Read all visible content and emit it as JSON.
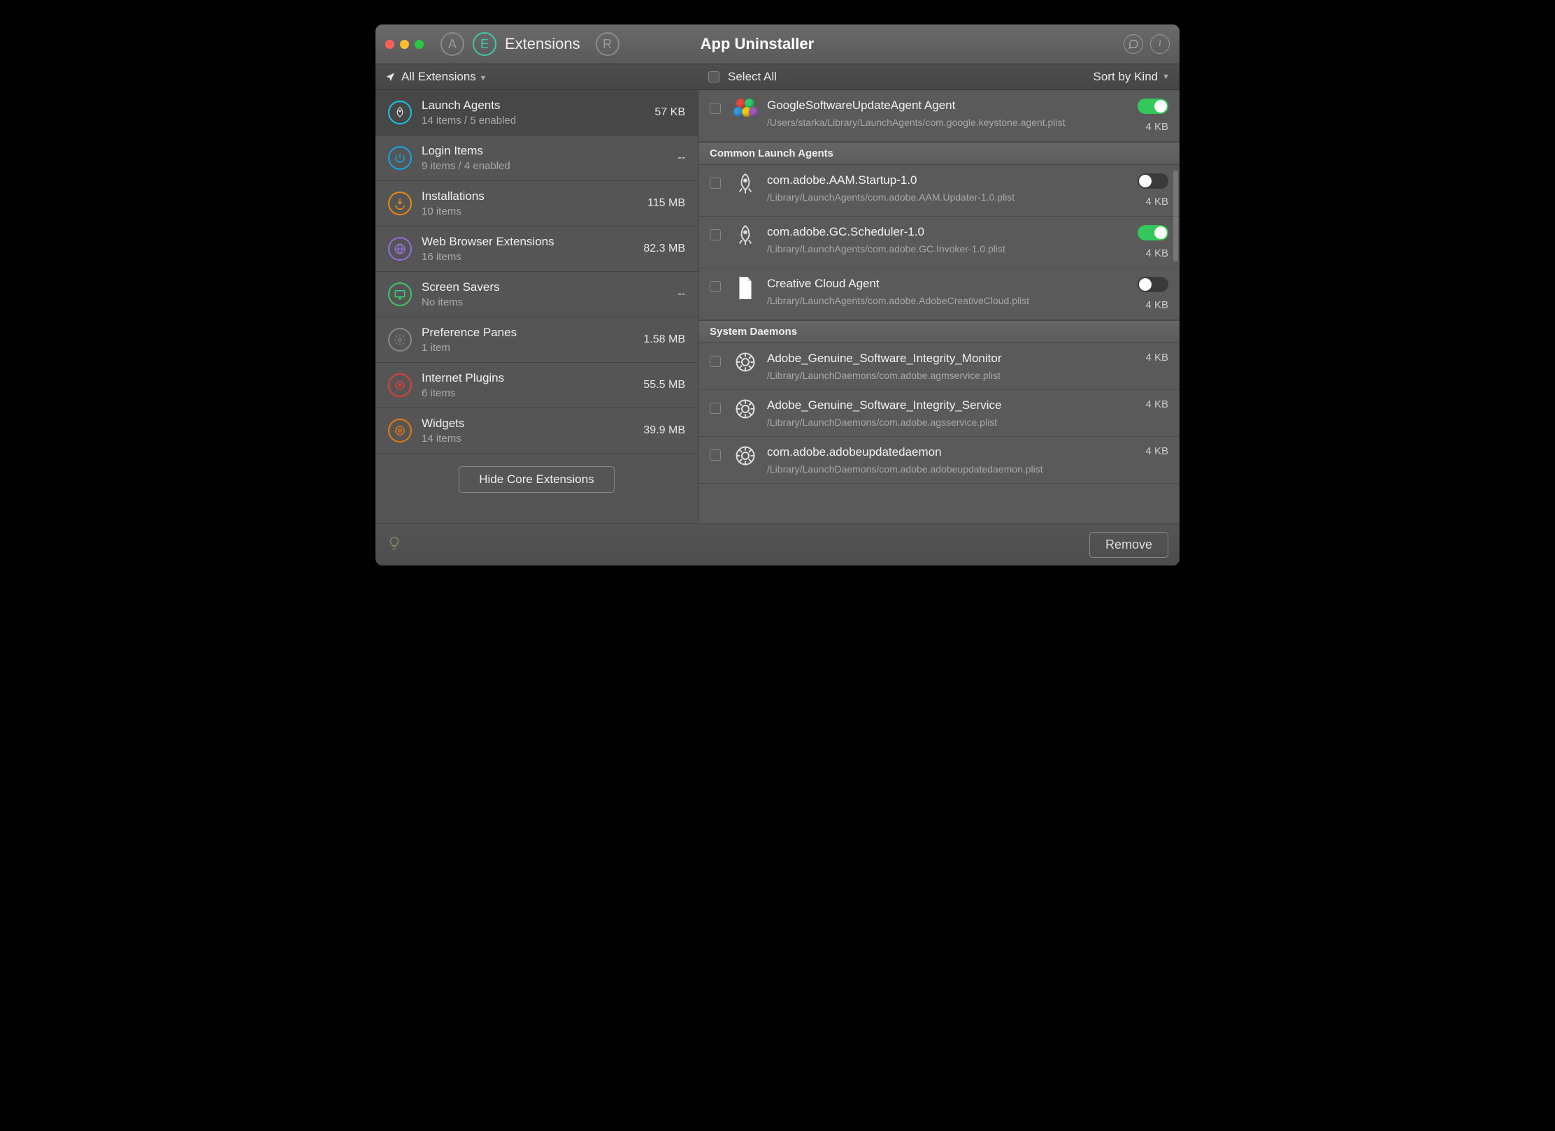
{
  "header": {
    "tab_label": "Extensions",
    "app_title": "App Uninstaller"
  },
  "subbar": {
    "filter_label": "All Extensions",
    "select_all_label": "Select All",
    "sort_label": "Sort by Kind"
  },
  "sidebar": {
    "categories": [
      {
        "title": "Launch Agents",
        "sub": "14 items / 5 enabled",
        "size": "57 KB",
        "color": "#16c4ea",
        "kind": "rocket"
      },
      {
        "title": "Login Items",
        "sub": "9 items / 4 enabled",
        "size": "--",
        "color": "#12a7e8",
        "kind": "power"
      },
      {
        "title": "Installations",
        "sub": "10 items",
        "size": "115 MB",
        "color": "#e88b12",
        "kind": "download"
      },
      {
        "title": "Web Browser Extensions",
        "sub": "16 items",
        "size": "82.3 MB",
        "color": "#9a6de0",
        "kind": "globe"
      },
      {
        "title": "Screen Savers",
        "sub": "No items",
        "size": "--",
        "color": "#3fc96b",
        "kind": "screen"
      },
      {
        "title": "Preference Panes",
        "sub": "1 item",
        "size": "1.58 MB",
        "color": "#888888",
        "kind": "gear"
      },
      {
        "title": "Internet Plugins",
        "sub": "6 items",
        "size": "55.5 MB",
        "color": "#e83b3b",
        "kind": "plug"
      },
      {
        "title": "Widgets",
        "sub": "14 items",
        "size": "39.9 MB",
        "color": "#e87a12",
        "kind": "widget"
      }
    ],
    "hide_button": "Hide Core Extensions"
  },
  "detail": {
    "top_items": [
      {
        "title": "GoogleSoftwareUpdateAgent Agent",
        "path": "/Users/starka/Library/LaunchAgents/com.google.keystone.agent.plist",
        "size": "4 KB",
        "enabled": true,
        "icon": "colorballs"
      }
    ],
    "sections": [
      {
        "header": "Common Launch Agents",
        "items": [
          {
            "title": "com.adobe.AAM.Startup-1.0",
            "path": "/Library/LaunchAgents/com.adobe.AAM.Updater-1.0.plist",
            "size": "4 KB",
            "enabled": false,
            "icon": "rocket"
          },
          {
            "title": "com.adobe.GC.Scheduler-1.0",
            "path": "/Library/LaunchAgents/com.adobe.GC.Invoker-1.0.plist",
            "size": "4 KB",
            "enabled": true,
            "icon": "rocket"
          },
          {
            "title": "Creative Cloud Agent",
            "path": "/Library/LaunchAgents/com.adobe.AdobeCreativeCloud.plist",
            "size": "4 KB",
            "enabled": false,
            "icon": "file"
          }
        ]
      },
      {
        "header": "System Daemons",
        "items": [
          {
            "title": "Adobe_Genuine_Software_Integrity_Monitor",
            "path": "/Library/LaunchDaemons/com.adobe.agmservice.plist",
            "size": "4 KB",
            "enabled": null,
            "icon": "gear"
          },
          {
            "title": "Adobe_Genuine_Software_Integrity_Service",
            "path": "/Library/LaunchDaemons/com.adobe.agsservice.plist",
            "size": "4 KB",
            "enabled": null,
            "icon": "gear"
          },
          {
            "title": "com.adobe.adobeupdatedaemon",
            "path": "/Library/LaunchDaemons/com.adobe.adobeupdatedaemon.plist",
            "size": "4 KB",
            "enabled": null,
            "icon": "gear"
          }
        ]
      }
    ]
  },
  "footer": {
    "remove_label": "Remove"
  }
}
